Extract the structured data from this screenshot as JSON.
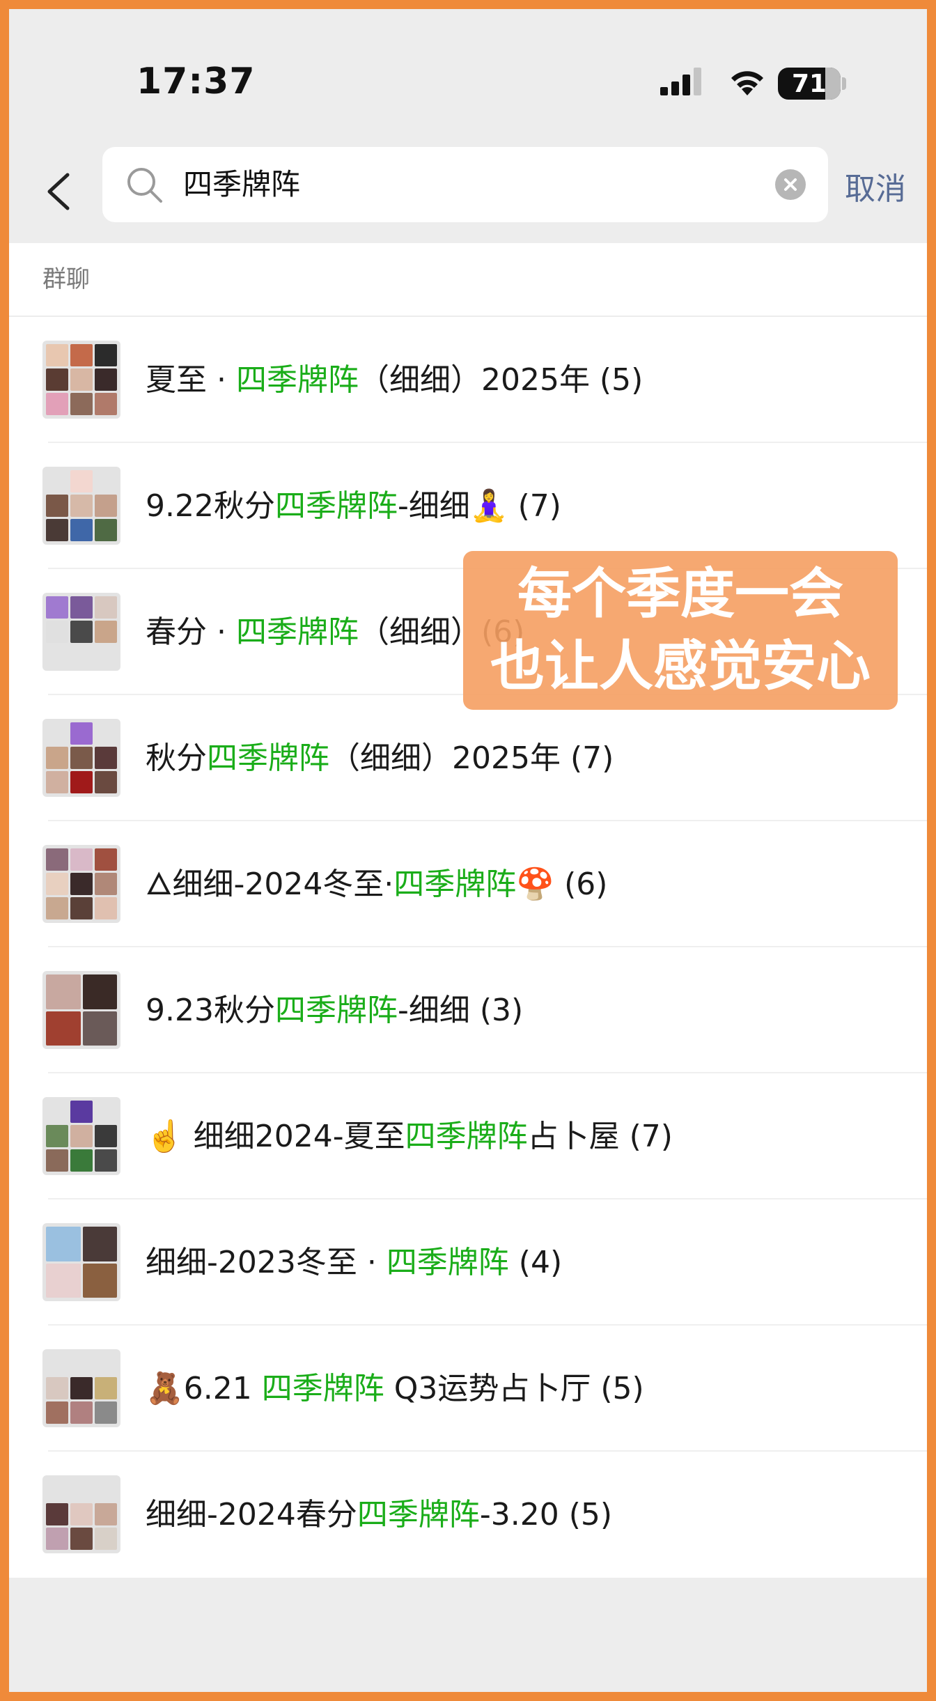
{
  "status_bar": {
    "time": "17:37",
    "battery": "71"
  },
  "search": {
    "query": "四季牌阵",
    "cancel_label": "取消"
  },
  "section": {
    "title": "群聊"
  },
  "highlight_term": "四季牌阵",
  "results": [
    {
      "pre": "夏至 · ",
      "hl": "四季牌阵",
      "post": "（细细）2025年 (5)"
    },
    {
      "pre": "9.22秋分",
      "hl": "四季牌阵",
      "post": "-细细🧘‍♀️ (7)"
    },
    {
      "pre": "春分 · ",
      "hl": "四季牌阵",
      "post": "（细细）(6)"
    },
    {
      "pre": "秋分",
      "hl": "四季牌阵",
      "post": "（细细）2025年 (7)"
    },
    {
      "pre": "🜂细细-2024冬至·",
      "hl": "四季牌阵",
      "post": "🍄 (6)"
    },
    {
      "pre": "9.23秋分",
      "hl": "四季牌阵",
      "post": "-细细 (3)"
    },
    {
      "pre": "☝️ 细细2024-夏至",
      "hl": "四季牌阵",
      "post": "占卜屋 (7)"
    },
    {
      "pre": "细细-2023冬至 · ",
      "hl": "四季牌阵",
      "post": " (4)"
    },
    {
      "pre": "🧸6.21 ",
      "hl": "四季牌阵",
      "post": " Q3运势占卜厅 (5)"
    },
    {
      "pre": "细细-2024春分",
      "hl": "四季牌阵",
      "post": "-3.20 (5)"
    }
  ],
  "overlay": {
    "line1": "每个季度一会",
    "line2": "也让人感觉安心"
  },
  "colors": {
    "highlight": "#1aad19",
    "link": "#576b95",
    "border": "#ef8a3a",
    "overlay": "#f59e62"
  }
}
